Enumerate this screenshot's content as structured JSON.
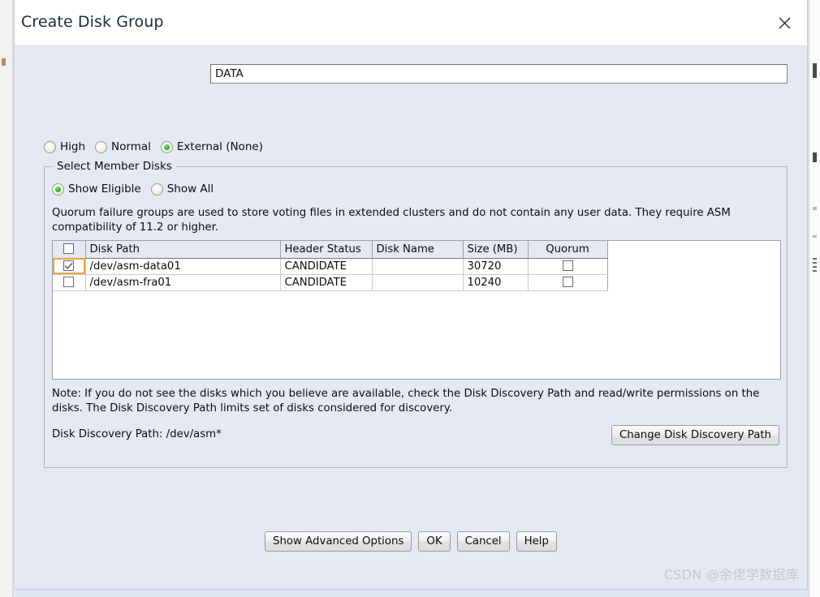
{
  "dialog": {
    "title": "Create Disk Group",
    "close_icon": "close-icon"
  },
  "name_field": {
    "value": "DATA",
    "placeholder": "Disk Group Name"
  },
  "redundancy": {
    "options": [
      {
        "label": "High",
        "selected": false
      },
      {
        "label": "Normal",
        "selected": false
      },
      {
        "label": "External (None)",
        "selected": true
      }
    ]
  },
  "member_disks": {
    "legend": "Select Member Disks",
    "filters": [
      {
        "label": "Show Eligible",
        "selected": true
      },
      {
        "label": "Show All",
        "selected": false
      }
    ],
    "quorum_note": "Quorum failure groups are used to store voting files in extended clusters and do not contain any user data. They require ASM compatibility of 11.2 or higher.",
    "columns": [
      "",
      "Disk Path",
      "Header Status",
      "Disk Name",
      "Size (MB)",
      "Quorum"
    ],
    "header_select_all_checked": false,
    "rows": [
      {
        "selected": true,
        "focused": true,
        "disk_path": "/dev/asm-data01",
        "header_status": "CANDIDATE",
        "disk_name": "",
        "size_mb": "30720",
        "quorum": false
      },
      {
        "selected": false,
        "focused": false,
        "disk_path": "/dev/asm-fra01",
        "header_status": "CANDIDATE",
        "disk_name": "",
        "size_mb": "10240",
        "quorum": false
      }
    ],
    "disk_note": "Note: If you do not see the disks which you believe are available, check the Disk Discovery Path and read/write permissions on the disks. The Disk Discovery Path limits set of disks considered for discovery.",
    "discovery_path_label": "Disk Discovery Path: /dev/asm*",
    "change_path_button": "Change Disk Discovery Path"
  },
  "footer": {
    "buttons": [
      "Show Advanced Options",
      "OK",
      "Cancel",
      "Help"
    ]
  },
  "watermark": "CSDN @余佬学数据库"
}
